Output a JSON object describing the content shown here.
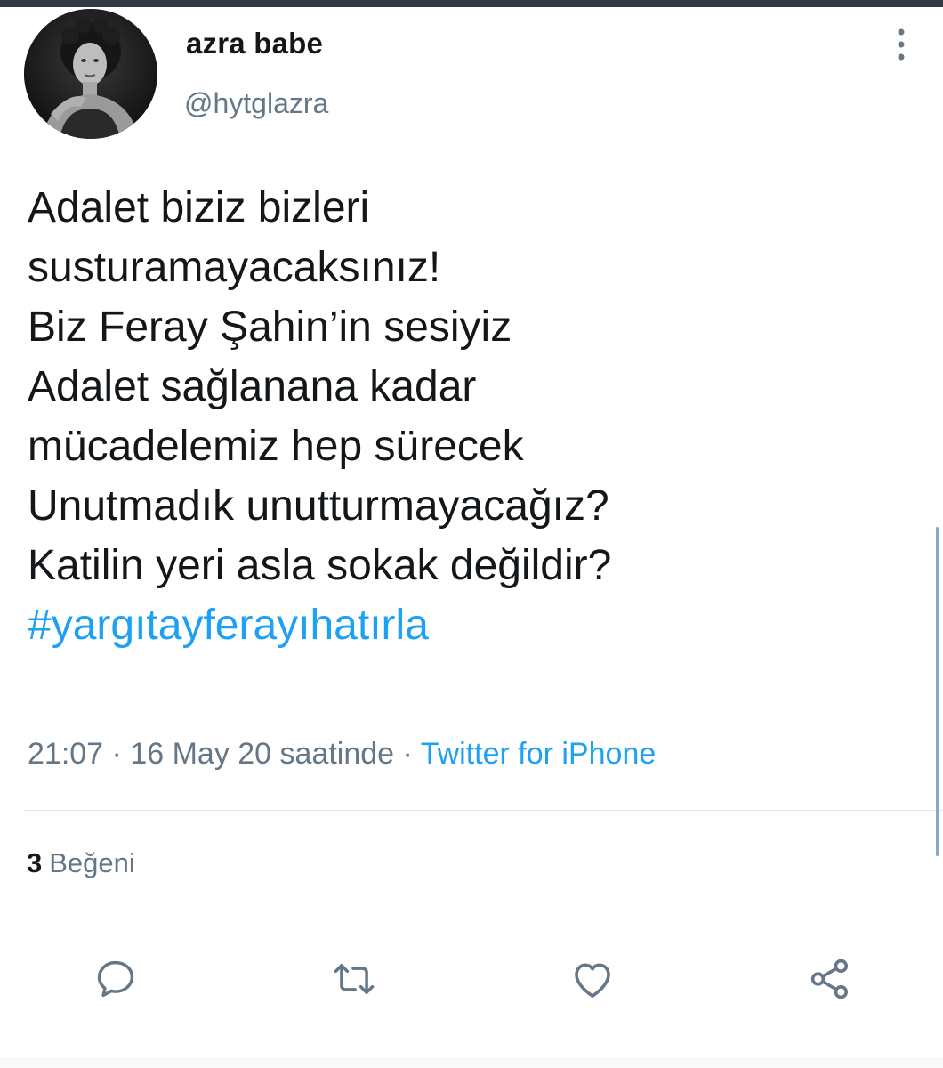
{
  "header": {
    "display_name": "azra babe",
    "handle": "@hytglazra"
  },
  "tweet": {
    "lines": [
      "Adalet biziz bizleri",
      "susturamayacaksınız!",
      "Biz Feray Şahin’in sesiyiz",
      "Adalet sağlanana kadar",
      "mücadelemiz hep sürecek",
      "Unutmadık unutturmayacağız?",
      "Katilin yeri asla sokak değildir?"
    ],
    "hashtag": "#yargıtayferayıhatırla"
  },
  "meta": {
    "time": "21:07",
    "separator": "·",
    "date": "16 May 20 saatinde",
    "source": "Twitter for iPhone"
  },
  "stats": {
    "likes_count": "3",
    "likes_label": "Beğeni"
  },
  "actions": {
    "icons": [
      "reply-icon",
      "retweet-icon",
      "like-icon",
      "share-icon"
    ]
  },
  "colors": {
    "text": "#14171a",
    "secondary": "#657786",
    "link": "#1da1f2",
    "divider": "#e1e8ed",
    "icon": "#657786"
  }
}
